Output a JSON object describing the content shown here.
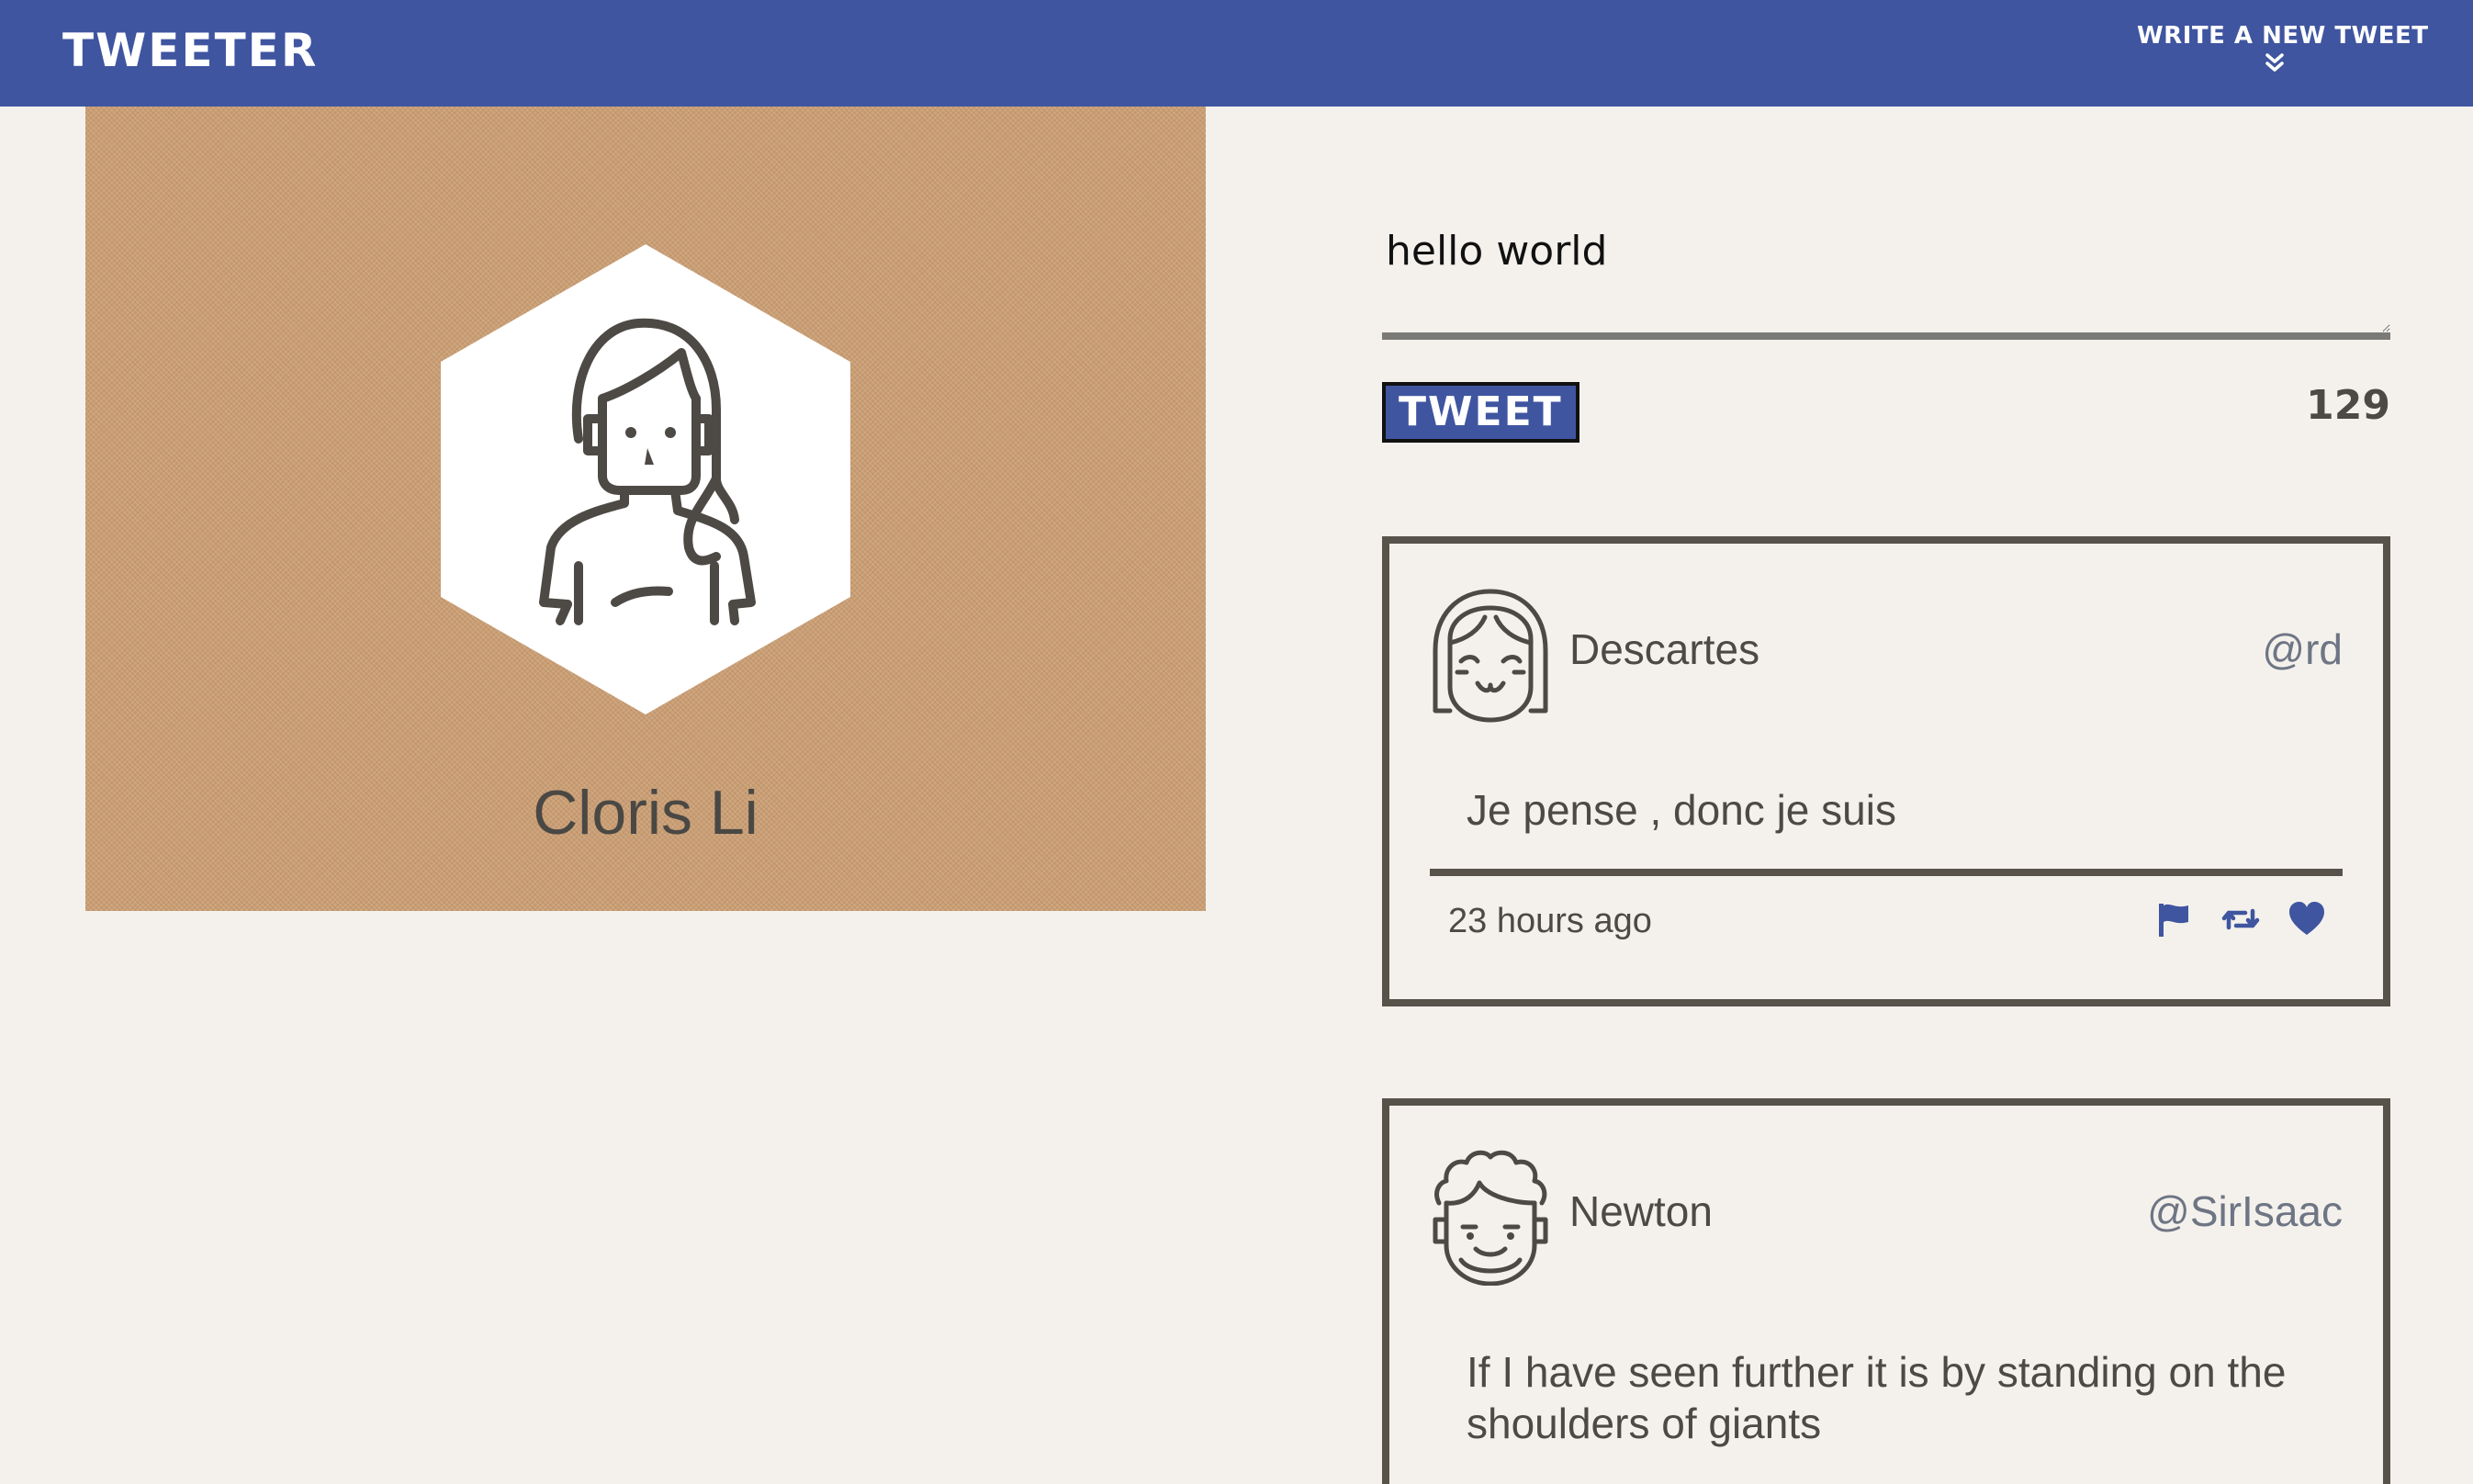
{
  "app": {
    "brand": "TWEETER",
    "accent_color": "#3f55a0",
    "nav_toggle_label": "WRITE A NEW TWEET",
    "nav_toggle_icon": "double-chevron-down-icon"
  },
  "profile": {
    "name": "Cloris Li",
    "avatar_icon": "woman-avatar-icon",
    "background_color": "#cc9f74"
  },
  "compose": {
    "input_value": "hello world",
    "button_label": "TWEET",
    "char_counter": "129"
  },
  "tweets": [
    {
      "name": "Descartes",
      "handle": "@rd",
      "content": "Je pense , donc je suis",
      "time": "23 hours ago",
      "avatar_icon": "smiling-girl-avatar-icon",
      "actions": [
        "flag-icon",
        "retweet-icon",
        "heart-icon"
      ]
    },
    {
      "name": "Newton",
      "handle": "@SirIsaac",
      "content": "If I have seen further it is by standing on the shoulders of giants",
      "avatar_icon": "curly-hair-man-avatar-icon"
    }
  ]
}
